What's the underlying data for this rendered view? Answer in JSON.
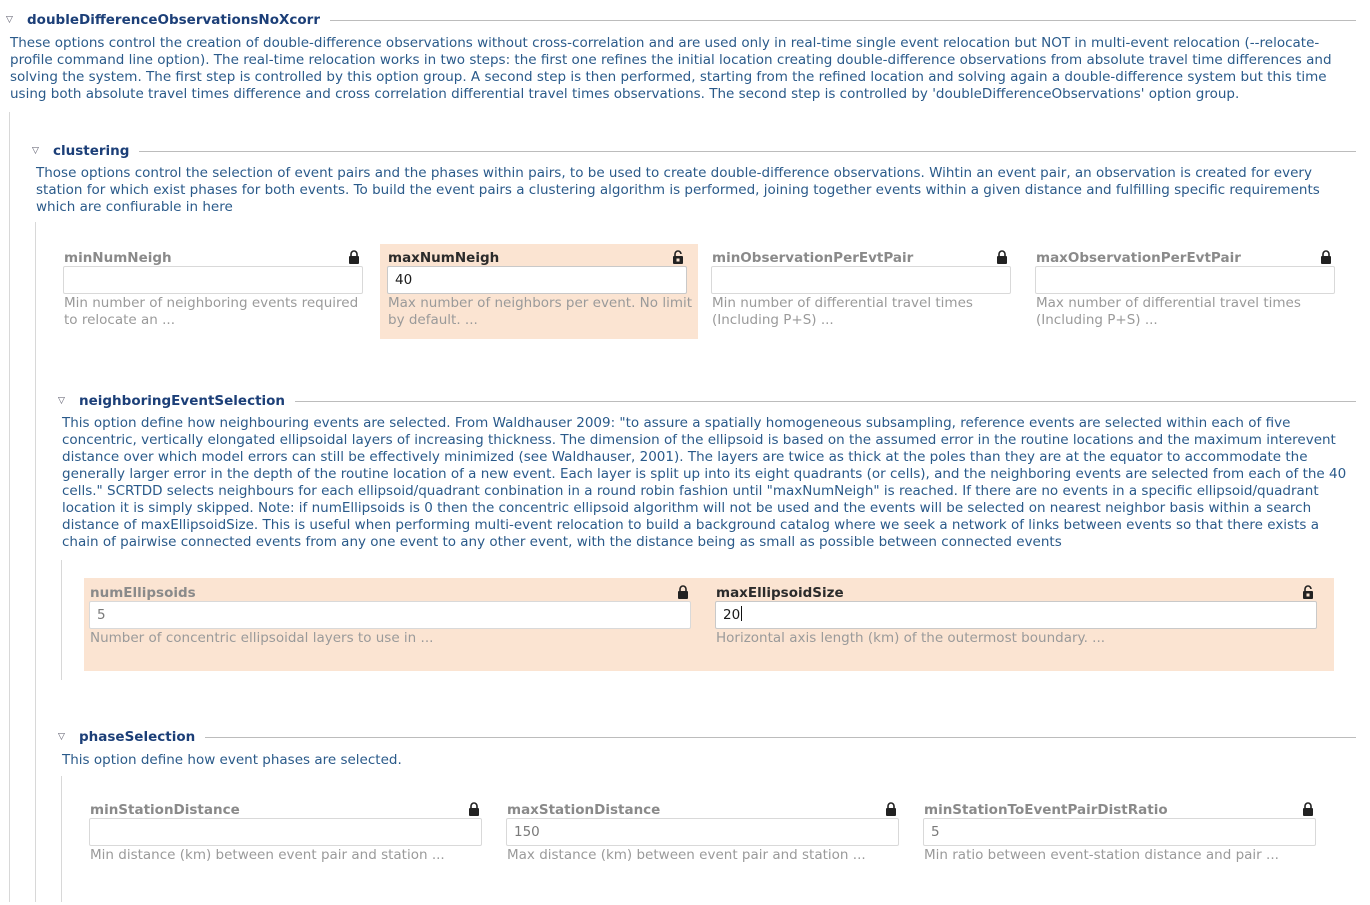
{
  "groups": {
    "dd": {
      "title": "doubleDifferenceObservationsNoXcorr",
      "desc": "These options control the creation of double-difference observations without cross-correlation and are used only in real-time single event relocation but NOT in multi-event relocation (--relocate-profile command line option). The real-time relocation works in two steps: the first one refines the initial location creating double-difference observations from absolute travel time differences and solving the system. The first step is controlled by this option group. A second step is then performed, starting from the refined location and solving again a double-difference system but this time using both absolute travel times difference and cross correlation differential travel times observations. The second step is controlled by 'doubleDifferenceObservations' option group."
    },
    "clustering": {
      "title": "clustering",
      "desc": "Those options control the selection of event pairs and the phases within pairs, to be used to create double-difference observations. Wihtin an event pair, an observation is created for every station for which exist phases for both events. To build the event pairs a clustering algorithm is performed, joining together events within a given distance and fulfilling specific requirements which are confiurable in here",
      "params": [
        {
          "label": "minNumNeigh",
          "value": "",
          "desc1": "Min number of neighboring events required",
          "desc2": "to relocate an ..."
        },
        {
          "label": "maxNumNeigh",
          "value": "40",
          "desc1": "Max number of neighbors per event. No limit",
          "desc2": "by default. ..."
        },
        {
          "label": "minObservationPerEvtPair",
          "value": "",
          "desc1": "Min number of differential travel times",
          "desc2": "(Including P+S) ..."
        },
        {
          "label": "maxObservationPerEvtPair",
          "value": "",
          "desc1": "Max number of differential travel times",
          "desc2": "(Including P+S) ..."
        }
      ]
    },
    "neighboring": {
      "title": "neighboringEventSelection",
      "desc": "This option define how neighbouring events are selected. From Waldhauser 2009: \"to assure a spatially homogeneous subsampling, reference events are selected within each of five concentric, vertically elongated ellipsoidal layers of increasing thickness. The dimension of the ellipsoid is based on the assumed error in the routine locations and the maximum interevent distance over which model errors can still be effectively minimized (see Waldhauser, 2001). The layers are twice as thick at the poles than they are at the equator to accommodate the generally larger error in the depth of the routine location of a new event. Each layer is split up into its eight quadrants (or cells), and the neighboring events are selected from each of the 40 cells.\" SCRTDD selects neighbours for each ellipsoid/quadrant conbination in a round robin fashion until \"maxNumNeigh\" is reached. If there are no events in a specific ellipsoid/quadrant location it is simply skipped. Note: if numEllipsoids is 0 then the concentric ellipsoid algorithm will not be used and the events will be selected on nearest neighbor basis within a search distance of maxEllipsoidSize. This is useful when performing multi-event relocation to build a background catalog where we seek a network of links between events so that there exists a chain of pairwise connected events from any one event to any other event, with the distance being as small as possible between connected events",
      "params": [
        {
          "label": "numEllipsoids",
          "value": "5",
          "desc": "Number of concentric ellipsoidal layers to use in ..."
        },
        {
          "label": "maxEllipsoidSize",
          "value": "20",
          "desc": "Horizontal axis length (km) of the outermost boundary. ..."
        }
      ]
    },
    "phase": {
      "title": "phaseSelection",
      "desc": "This option define how event phases are selected.",
      "params": [
        {
          "label": "minStationDistance",
          "value": "",
          "desc": "Min distance (km) between event pair and station ..."
        },
        {
          "label": "maxStationDistance",
          "value": "150",
          "desc": "Max distance (km) between event pair and station ..."
        },
        {
          "label": "minStationToEventPairDistRatio",
          "value": "5",
          "desc": "Min ratio between event-station distance and pair ..."
        }
      ]
    }
  },
  "icons": {
    "collapse": "triangle-down-icon",
    "lock": "lock-icon",
    "unlock": "unlock-icon"
  },
  "colors": {
    "accent": "#1c3f78",
    "text": "#2a5a8a",
    "highlight": "#fbe4d2"
  }
}
